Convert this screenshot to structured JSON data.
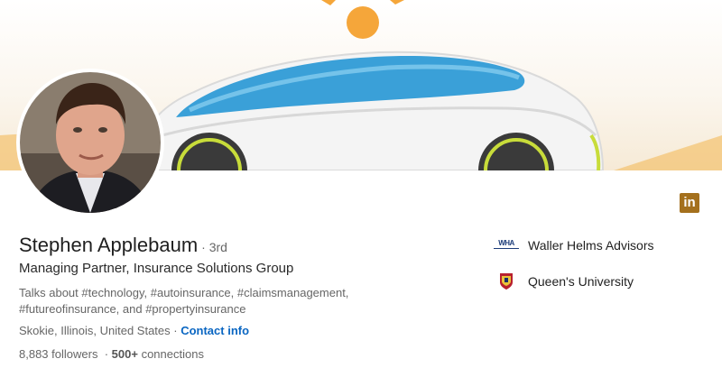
{
  "profile": {
    "name": "Stephen Applebaum",
    "degree": "· 3rd",
    "headline": "Managing Partner, Insurance Solutions Group",
    "talks_about": "Talks about #technology, #autoinsurance, #claimsmanagement, #futureofinsurance, and #propertyinsurance",
    "location": "Skokie, Illinois, United States ·",
    "contact_label": "Contact info",
    "followers": "8,883 followers",
    "connections_separator": "·",
    "connections_count": "500+",
    "connections_label": "connections"
  },
  "organizations": [
    {
      "name": "Waller Helms Advisors",
      "logo_text": "WHA",
      "icon": "waller-helms-logo-icon"
    },
    {
      "name": "Queen's University",
      "icon": "queens-university-crest-icon"
    }
  ],
  "linkedin_icon": {
    "icon": "linkedin-icon",
    "text": "in",
    "color": "#a4701d"
  },
  "colors": {
    "link": "#0a66c2",
    "banner_accent": "#f5a63a",
    "car_blue": "#3a9fd8"
  }
}
